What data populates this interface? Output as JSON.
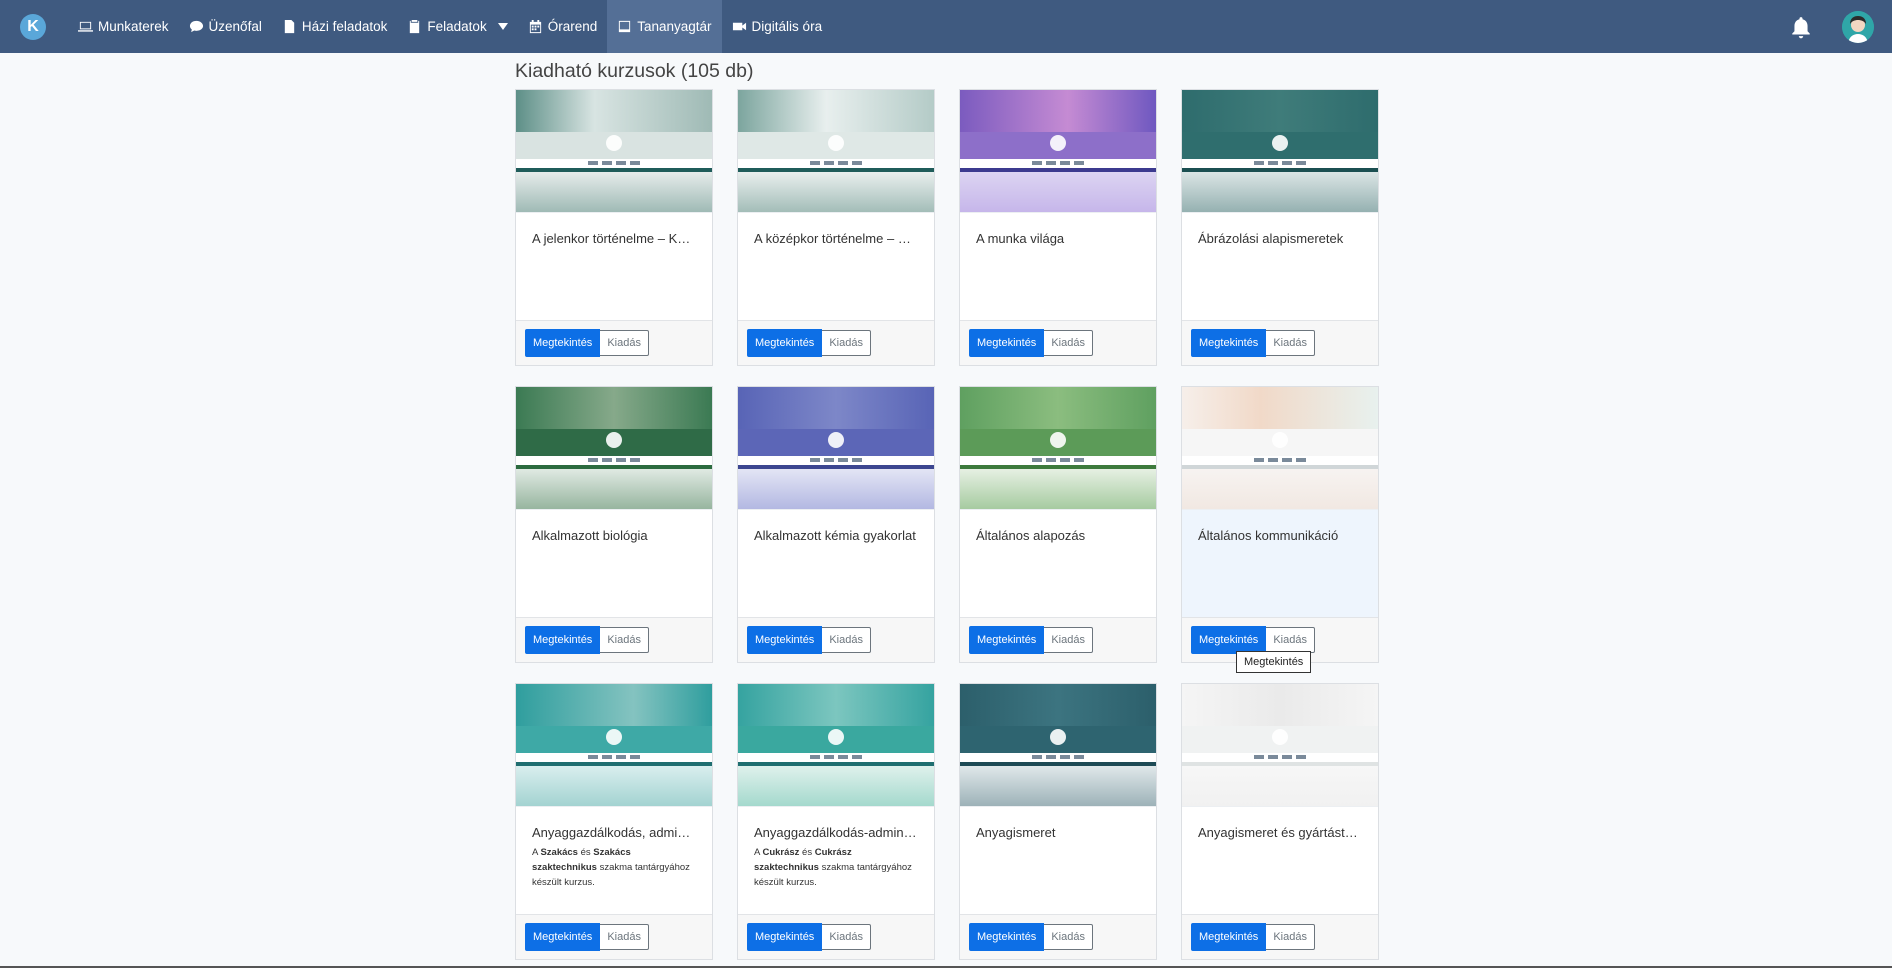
{
  "nav": {
    "logo": "K",
    "items": [
      {
        "label": "Munkaterek",
        "icon": "laptop-icon"
      },
      {
        "label": "Üzenőfal",
        "icon": "chat-bubble-icon"
      },
      {
        "label": "Házi feladatok",
        "icon": "document-icon"
      },
      {
        "label": "Feladatok",
        "icon": "clipboard-icon"
      },
      {
        "label": "Órarend",
        "icon": "calendar-icon"
      },
      {
        "label": "Tananyagtár",
        "icon": "book-icon"
      },
      {
        "label": "Digitális óra",
        "icon": "video-camera-icon"
      }
    ],
    "active": "Tananyagtár"
  },
  "page": {
    "title": "Kiadható kurzusok (105 db)"
  },
  "cards": [
    {
      "title": "A jelenkor történelme – Köz...",
      "desc": null,
      "view_label": "Megtekintés",
      "issue_label": "Kiadás"
    },
    {
      "title": "A középkor történelme – Kö...",
      "desc": null,
      "view_label": "Megtekintés",
      "issue_label": "Kiadás"
    },
    {
      "title": "A munka világa",
      "desc": null,
      "view_label": "Megtekintés",
      "issue_label": "Kiadás"
    },
    {
      "title": "Ábrázolási alapismeretek",
      "desc": null,
      "view_label": "Megtekintés",
      "issue_label": "Kiadás"
    },
    {
      "title": "Alkalmazott biológia",
      "desc": null,
      "view_label": "Megtekintés",
      "issue_label": "Kiadás"
    },
    {
      "title": "Alkalmazott kémia gyakorlat",
      "desc": null,
      "view_label": "Megtekintés",
      "issue_label": "Kiadás"
    },
    {
      "title": "Általános alapozás",
      "desc": null,
      "view_label": "Megtekintés",
      "issue_label": "Kiadás"
    },
    {
      "title": "Általános kommunikáció",
      "desc": null,
      "view_label": "Megtekintés",
      "issue_label": "Kiadás"
    },
    {
      "title": "Anyaggazdálkodás, admini...",
      "desc": {
        "pre": "A ",
        "b1": "Szakács",
        "mid": " és ",
        "b2": "Szakács szaktechnikus",
        "post": " szakma tantárgyához készült kurzus."
      },
      "view_label": "Megtekintés",
      "issue_label": "Kiadás"
    },
    {
      "title": "Anyaggazdálkodás-adminis...",
      "desc": {
        "pre": "A ",
        "b1": "Cukrász",
        "mid": " és ",
        "b2": "Cukrász szaktechnikus",
        "post": " szakma tantárgyához készült kurzus."
      },
      "view_label": "Megtekintés",
      "issue_label": "Kiadás"
    },
    {
      "title": "Anyagismeret",
      "desc": null,
      "view_label": "Megtekintés",
      "issue_label": "Kiadás"
    },
    {
      "title": "Anyagismeret és gyártáste...",
      "desc": null,
      "view_label": "Megtekintés",
      "issue_label": "Kiadás"
    }
  ],
  "tooltip": "Megtekintés",
  "colors": {
    "navbar": "#3f5a80",
    "primary_button": "#0d6fe6"
  }
}
